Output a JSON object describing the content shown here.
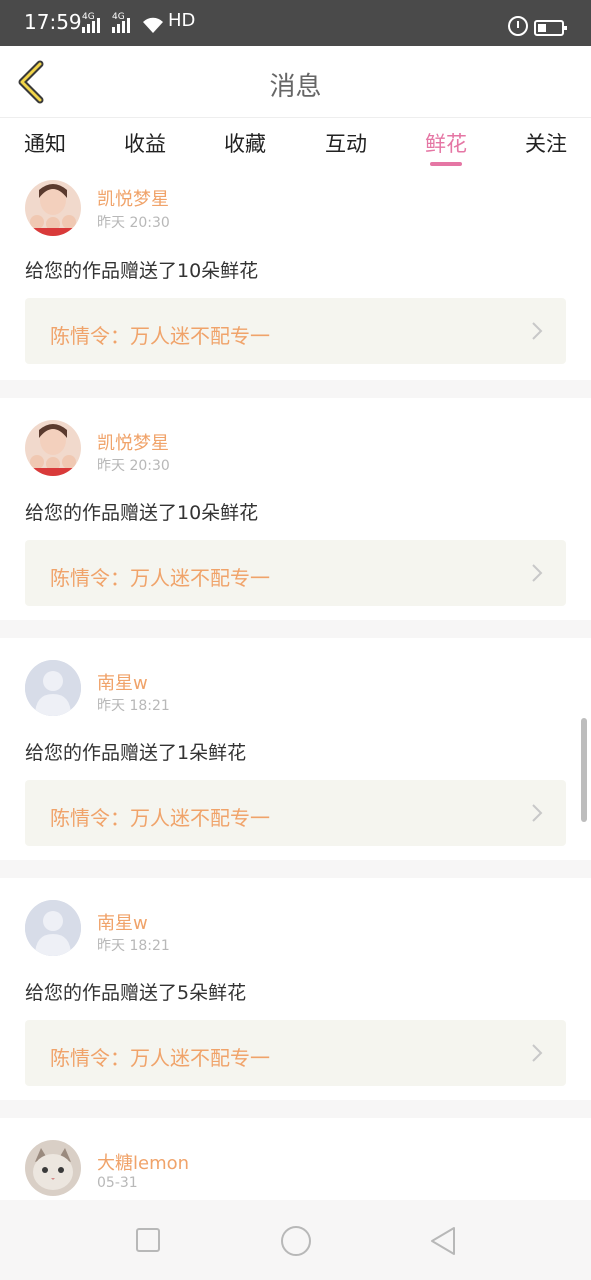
{
  "status_bar": {
    "time": "17:59",
    "network1": "4G",
    "network2": "4G",
    "hd": "HD"
  },
  "header": {
    "title": "消息",
    "back_icon": "chevron-left-icon",
    "accent_color": "#e576a4"
  },
  "tabs": [
    {
      "label": "通知",
      "active": false
    },
    {
      "label": "收益",
      "active": false
    },
    {
      "label": "收藏",
      "active": false
    },
    {
      "label": "互动",
      "active": false
    },
    {
      "label": "鲜花",
      "active": true
    },
    {
      "label": "关注",
      "active": false
    }
  ],
  "messages": [
    {
      "username": "凯悦梦星",
      "time": "昨天 20:30",
      "text": "给您的作品赠送了10朵鲜花",
      "work": "陈情令：万人迷不配专一",
      "avatar": "photo-avatar"
    },
    {
      "username": "凯悦梦星",
      "time": "昨天 20:30",
      "text": "给您的作品赠送了10朵鲜花",
      "work": "陈情令：万人迷不配专一",
      "avatar": "photo-avatar"
    },
    {
      "username": "南星w",
      "time": "昨天 18:21",
      "text": "给您的作品赠送了1朵鲜花",
      "work": "陈情令：万人迷不配专一",
      "avatar": "default-avatar"
    },
    {
      "username": "南星w",
      "time": "昨天 18:21",
      "text": "给您的作品赠送了5朵鲜花",
      "work": "陈情令：万人迷不配专一",
      "avatar": "default-avatar"
    },
    {
      "username": "大糖lemon",
      "time": "05-31",
      "text": "",
      "work": "",
      "avatar": "cat-avatar"
    }
  ]
}
